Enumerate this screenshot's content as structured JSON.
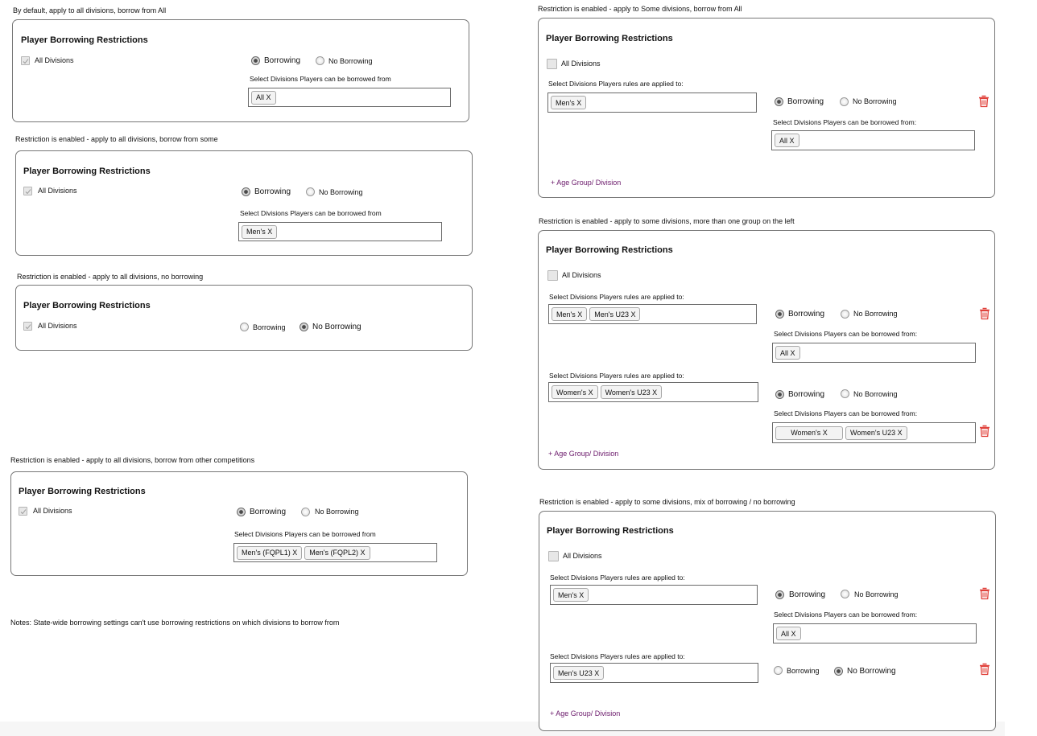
{
  "common": {
    "panel_title": "Player Borrowing Restrictions",
    "all_divisions": "All Divisions",
    "borrowing": "Borrowing",
    "no_borrowing": "No Borrowing",
    "borrow_from_label": "Select Divisions Players can be borrowed from",
    "borrow_from_label_colon": "Select Divisions Players can be borrowed from:",
    "applied_to_label": "Select Divisions Players rules are applied to:",
    "add_group_link": "+ Age Group/ Division",
    "trash_icon": "trash-icon",
    "trash_color": "#e0403a",
    "link_color": "#6b1a6b"
  },
  "scenarios": {
    "s1": {
      "caption": "By default, apply to all divisions, borrow from All",
      "all_divisions_checked": true,
      "mode": "Borrowing",
      "borrow_from": [
        "All X"
      ]
    },
    "s2": {
      "caption": "Restriction is enabled - apply to all divisions, borrow from some",
      "all_divisions_checked": true,
      "mode": "Borrowing",
      "borrow_from": [
        "Men's  X"
      ]
    },
    "s3": {
      "caption": "Restriction is enabled - apply to all divisions, no borrowing",
      "all_divisions_checked": true,
      "mode": "No Borrowing"
    },
    "s4": {
      "caption": "Restriction is enabled - apply to all divisions, borrow from other competitions",
      "all_divisions_checked": true,
      "mode": "Borrowing",
      "borrow_from": [
        "Men's (FQPL1)  X",
        "Men's (FQPL2)  X"
      ]
    },
    "s5": {
      "caption": "Restriction is enabled - apply to Some divisions, borrow from All",
      "all_divisions_checked": false,
      "rules": [
        {
          "applied_to": [
            "Men's  X"
          ],
          "mode": "Borrowing",
          "borrow_from": [
            "All X"
          ]
        }
      ]
    },
    "s6": {
      "caption": "Restriction is enabled - apply to some divisions, more than one group on the left",
      "all_divisions_checked": false,
      "rules": [
        {
          "applied_to": [
            "Men's  X",
            "Men's U23  X"
          ],
          "mode": "Borrowing",
          "borrow_from": [
            "All X"
          ]
        },
        {
          "applied_to": [
            "Women's  X",
            "Women's U23  X"
          ],
          "mode": "Borrowing",
          "borrow_from": [
            "Women's X",
            "Women's U23 X"
          ]
        }
      ]
    },
    "s7": {
      "caption": "Restriction is enabled - apply to some divisions, mix of borrowing / no borrowing",
      "all_divisions_checked": false,
      "rules": [
        {
          "applied_to": [
            "Men's  X"
          ],
          "mode": "Borrowing",
          "borrow_from": [
            "All X"
          ]
        },
        {
          "applied_to": [
            "Men's U23  X"
          ],
          "mode": "No Borrowing"
        }
      ]
    }
  },
  "notes": "Notes: State-wide borrowing settings can't use borrowing restrictions on which divisions to borrow from"
}
